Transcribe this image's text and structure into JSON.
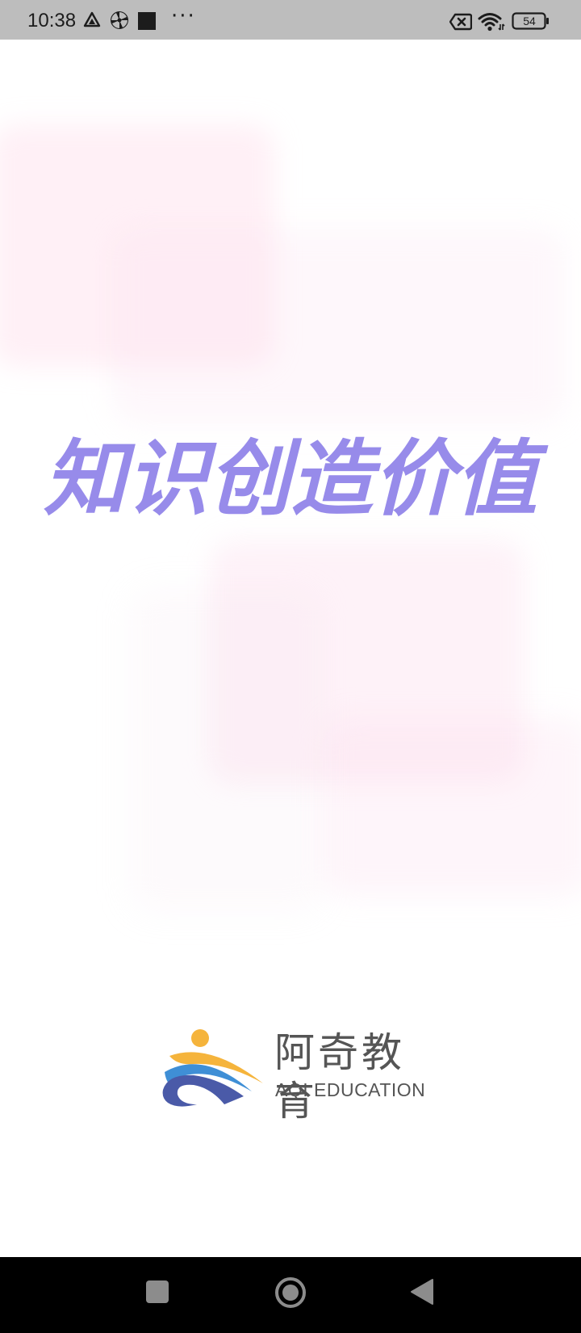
{
  "status_bar": {
    "time": "10:38",
    "dots": "···",
    "battery": "54",
    "icons": [
      "drive-icon",
      "pinwheel-icon",
      "square-notification-icon",
      "sim-blocked-icon",
      "wifi-icon",
      "battery-icon"
    ]
  },
  "splash": {
    "slogan": "知识创造价值"
  },
  "brand": {
    "name_cn": "阿奇教育",
    "name_en": "AQI EDUCATION",
    "colors": {
      "orange": "#f5b43c",
      "blue_light": "#3f8fd6",
      "blue_dark": "#4a5aa8",
      "text": "#555555"
    }
  },
  "theme": {
    "accent": "#978bea",
    "status_bar": "#bdbdbd",
    "nav_bar": "#000000"
  },
  "nav_bar": {
    "buttons": [
      "recents-button",
      "home-button",
      "back-button"
    ]
  }
}
